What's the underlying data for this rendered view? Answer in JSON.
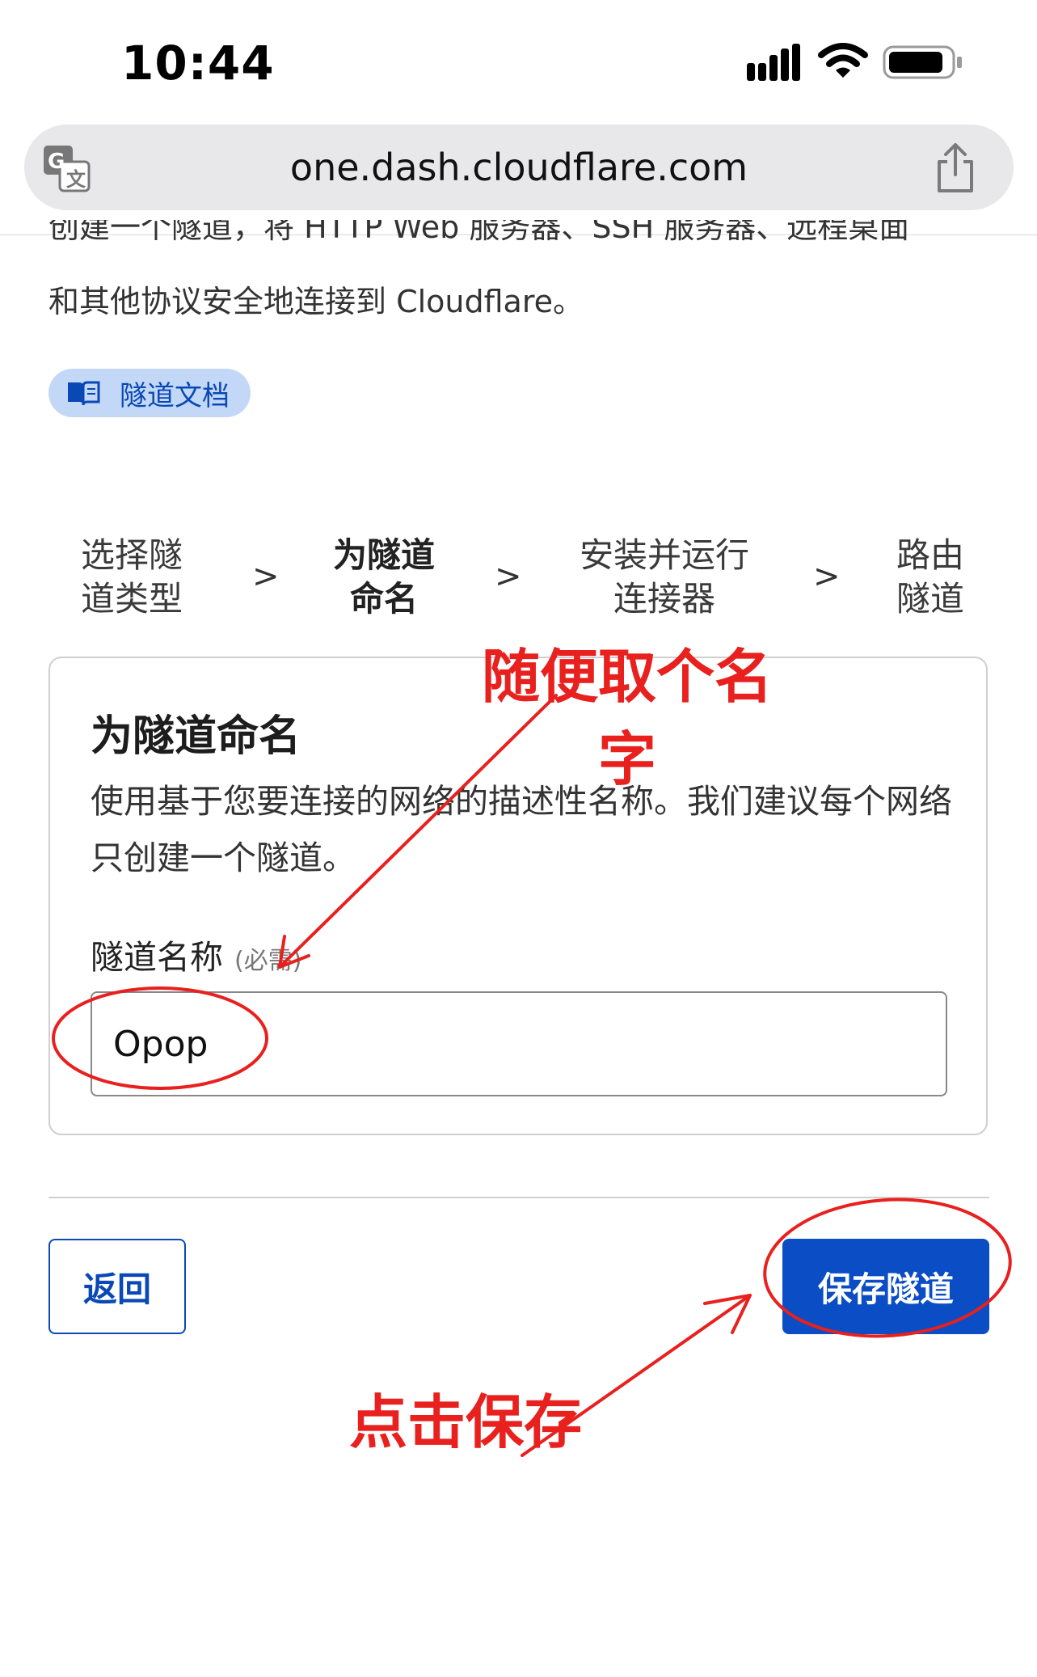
{
  "status_bar": {
    "time": "10:44"
  },
  "browser": {
    "url": "one.dash.cloudflare.com"
  },
  "intro": {
    "line1": "创建一个隧道，将 HTTP Web 服务器、SSH 服务器、远程桌面",
    "line2": "和其他协议安全地连接到 Cloudflare。",
    "doc_link": "隧道文档"
  },
  "steps": [
    {
      "label": "选择隧\n道类型"
    },
    {
      "label": "为隧道\n命名"
    },
    {
      "label": "安装并运行\n连接器"
    },
    {
      "label": "路由\n隧道"
    }
  ],
  "step_separator": ">",
  "card": {
    "title": "为隧道命名",
    "description": "使用基于您要连接的网络的描述性名称。我们建议每个网络只创建一个隧道。",
    "field_label": "隧道名称",
    "field_required": "(必需)",
    "field_value": "Opop"
  },
  "actions": {
    "back": "返回",
    "save": "保存隧道"
  },
  "annotations": {
    "name_hint_line1": "随便取个名",
    "name_hint_line2": "字",
    "save_hint": "点击保存"
  },
  "colors": {
    "accent": "#0a4dc4",
    "annotation": "#e8201e",
    "pill_bg": "#c3d8f7"
  }
}
